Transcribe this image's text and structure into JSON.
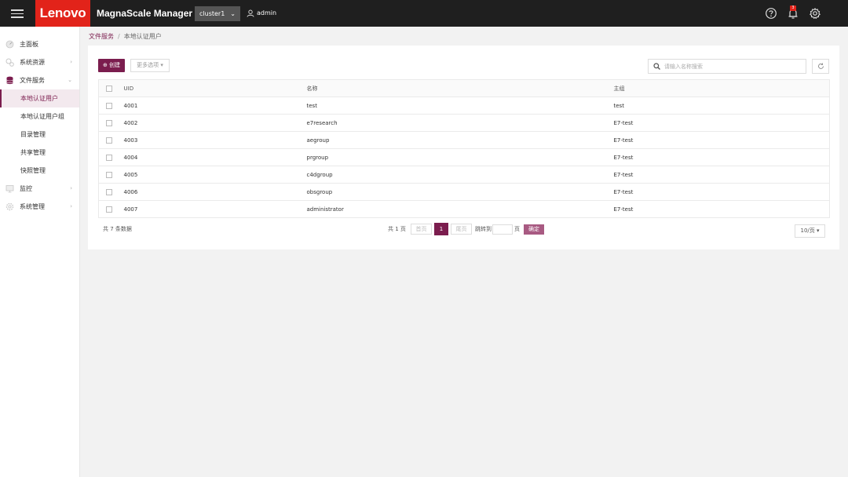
{
  "header": {
    "logo": "Lenovo",
    "app_title": "MagnaScale Manager",
    "cluster": "cluster1",
    "user": "admin",
    "notification_count": "3"
  },
  "sidebar": {
    "items": [
      {
        "label": "主面板",
        "icon": "dashboard-icon"
      },
      {
        "label": "系统资源",
        "icon": "resources-icon"
      },
      {
        "label": "文件服务",
        "icon": "database-icon"
      },
      {
        "label": "监控",
        "icon": "monitor-icon"
      },
      {
        "label": "系统管理",
        "icon": "settings-icon"
      }
    ],
    "sub_items": [
      {
        "label": "本地认证用户",
        "active": true
      },
      {
        "label": "本地认证用户组"
      },
      {
        "label": "目录管理"
      },
      {
        "label": "共享管理"
      },
      {
        "label": "快照管理"
      }
    ]
  },
  "breadcrumb": {
    "parent": "文件服务",
    "separator": "/",
    "current": "本地认证用户"
  },
  "toolbar": {
    "create_label": "⊕ 创建",
    "more_label": "更多选项 ▾",
    "search_placeholder": "请输入名称搜索"
  },
  "table": {
    "headers": [
      "UID",
      "名称",
      "主组"
    ],
    "rows": [
      {
        "uid": "4001",
        "name": "test",
        "group": "test"
      },
      {
        "uid": "4002",
        "name": "e7research",
        "group": "E7-test"
      },
      {
        "uid": "4003",
        "name": "aegroup",
        "group": "E7-test"
      },
      {
        "uid": "4004",
        "name": "prgroup",
        "group": "E7-test"
      },
      {
        "uid": "4005",
        "name": "c4dgroup",
        "group": "E7-test"
      },
      {
        "uid": "4006",
        "name": "obsgroup",
        "group": "E7-test"
      },
      {
        "uid": "4007",
        "name": "administrator",
        "group": "E7-test"
      }
    ]
  },
  "pagination": {
    "total": "共 7 条数据",
    "pages": "共 1 页",
    "prev": "首页",
    "current": "1",
    "next": "尾页",
    "jump_to": "跳转到",
    "page_unit": "页",
    "confirm": "确定",
    "page_size": "10/页 ▾"
  },
  "colors": {
    "accent": "#7b1d4e",
    "brand": "#e2231a",
    "topbar": "#1f1f1f"
  }
}
